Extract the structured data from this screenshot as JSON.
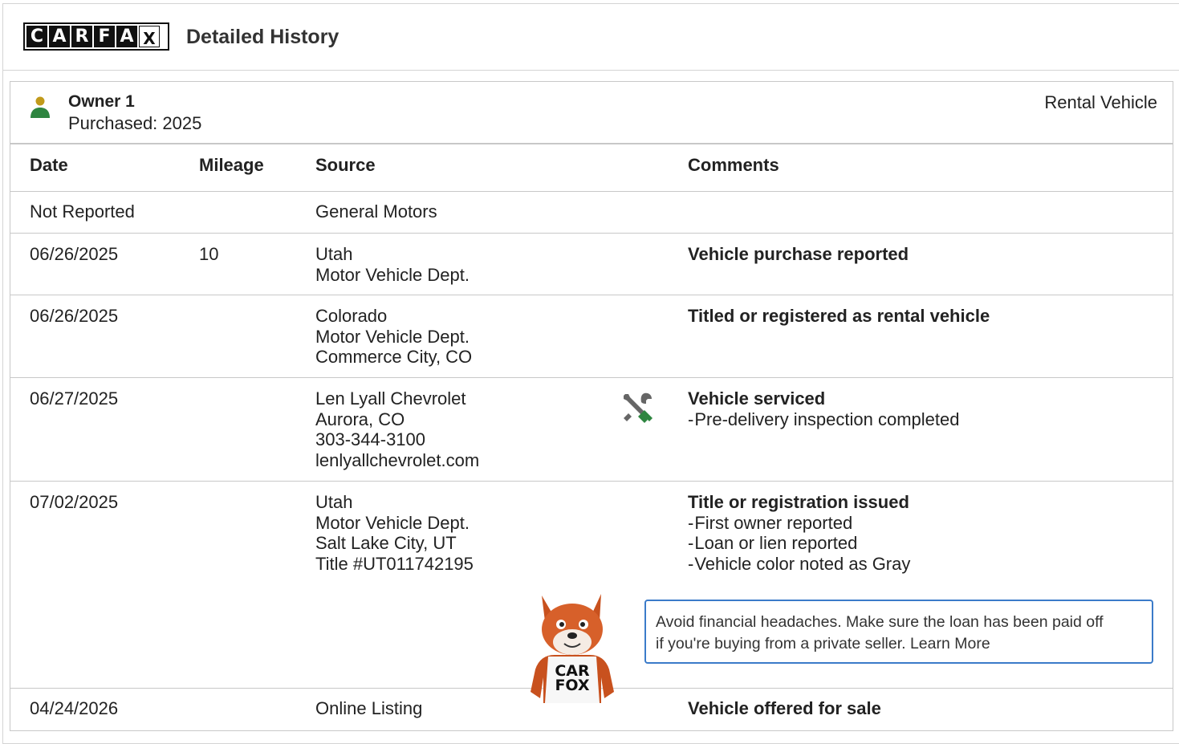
{
  "header": {
    "brand_letters": [
      "C",
      "A",
      "R",
      "F",
      "A",
      "X"
    ],
    "title": "Detailed History"
  },
  "owner": {
    "name": "Owner 1",
    "purchased": "Purchased: 2025",
    "vehicle_type": "Rental Vehicle",
    "icon": "person-icon"
  },
  "table": {
    "columns": [
      "Date",
      "Mileage",
      "Source",
      "Comments"
    ],
    "rows": [
      {
        "date": "Not Reported",
        "mileage": "",
        "source": [
          "General Motors"
        ],
        "comment_head": "",
        "comment_items": []
      },
      {
        "date": "06/26/2025",
        "mileage": "10",
        "source": [
          "Utah",
          "Motor Vehicle Dept."
        ],
        "comment_head": "Vehicle purchase reported",
        "comment_items": []
      },
      {
        "date": "06/26/2025",
        "mileage": "",
        "source": [
          "Colorado",
          "Motor Vehicle Dept.",
          "Commerce City, CO"
        ],
        "comment_head": "Titled or registered as rental vehicle",
        "comment_items": []
      },
      {
        "date": "06/27/2025",
        "mileage": "",
        "source": [
          "Len Lyall Chevrolet",
          "Aurora, CO",
          "303-344-3100",
          "lenlyallchevrolet.com"
        ],
        "comment_head": "Vehicle serviced",
        "comment_items": [
          "Pre-delivery inspection completed"
        ],
        "icon": "service-wrench-icon"
      },
      {
        "date": "07/02/2025",
        "mileage": "",
        "source": [
          "Utah",
          "Motor Vehicle Dept.",
          "Salt Lake City, UT",
          "Title #UT011742195"
        ],
        "comment_head": "Title or registration issued",
        "comment_items": [
          "First owner reported",
          "Loan or lien reported",
          "Vehicle color noted as Gray"
        ]
      },
      {
        "date": "04/24/2026",
        "mileage": "",
        "source": [
          "Online Listing"
        ],
        "comment_head": "Vehicle offered for sale",
        "comment_items": []
      }
    ]
  },
  "notice": {
    "text_line1": "Avoid financial headaches. Make sure the loan has been paid off",
    "text_line2": "if you're buying from a private seller. Learn More",
    "mascot_shirt_line1": "CAR",
    "mascot_shirt_line2": "FOX"
  },
  "colors": {
    "border": "#c8c8c8",
    "notice_border": "#3b7bc9",
    "person_head": "#c19a1b",
    "person_body": "#2e8540",
    "wrench_green": "#2e8540",
    "wrench_gray": "#666666"
  }
}
